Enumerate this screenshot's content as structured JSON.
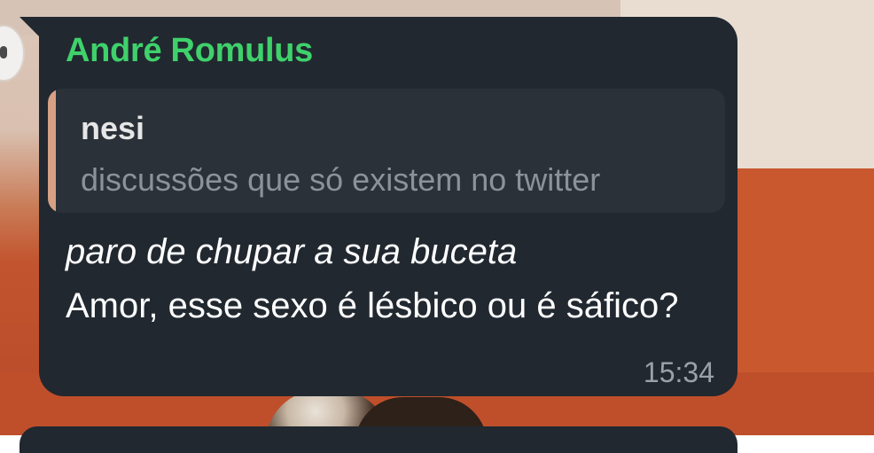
{
  "message": {
    "sender_name": "André Romulus",
    "sender_color": "#3fd16b",
    "reply": {
      "author": "nesi",
      "text": "discussões que só existem no twitter",
      "bar_color": "#d6a084"
    },
    "italic_line": "paro de chupar a sua buceta",
    "body": "Amor, esse sexo é lésbico ou é sáfico?",
    "time": "15:34"
  },
  "theme": {
    "bubble_color": "#212830",
    "reply_bg": "#2a3139"
  }
}
